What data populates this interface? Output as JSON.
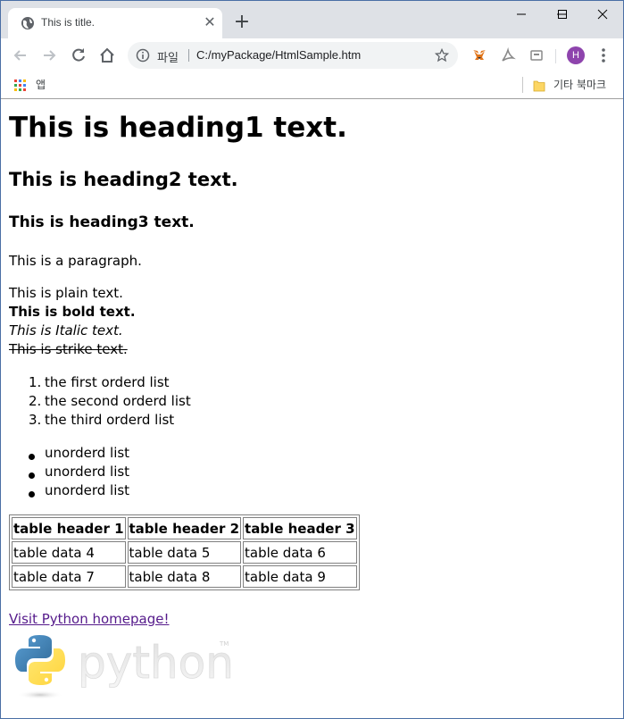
{
  "tab": {
    "title": "This is title."
  },
  "omnibox": {
    "scheme_label": "파일",
    "url": "C:/myPackage/HtmlSample.htm"
  },
  "profile": {
    "initial": "H",
    "color": "#8e44ad"
  },
  "bookmarks": {
    "apps_label": "앱",
    "other_label": "기타 북마크"
  },
  "page": {
    "h1": "This is heading1 text.",
    "h2": "This is heading2 text.",
    "h3": "This is heading3 text.",
    "paragraph": "This is a paragraph.",
    "plain": "This is plain text.",
    "bold": "This is bold text.",
    "italic": "This is Italic text.",
    "strike": "This is strike text.",
    "ordered_list": [
      "the first orderd list",
      "the second orderd list",
      "the third orderd list"
    ],
    "unordered_list": [
      "unorderd list",
      "unorderd list",
      "unorderd list"
    ],
    "table": {
      "headers": [
        "table header 1",
        "table header 2",
        "table header 3"
      ],
      "rows": [
        [
          "table data 4",
          "table data 5",
          "table data 6"
        ],
        [
          "table data 7",
          "table data 8",
          "table data 9"
        ]
      ]
    },
    "link": "Visit Python homepage!",
    "logo_text": "python",
    "logo_tm": "TM"
  },
  "colors": {
    "link_visited": "#551a8b",
    "tabstrip": "#dee1e6",
    "python_blue": "#3b74a8",
    "python_yellow": "#ffd43b"
  }
}
